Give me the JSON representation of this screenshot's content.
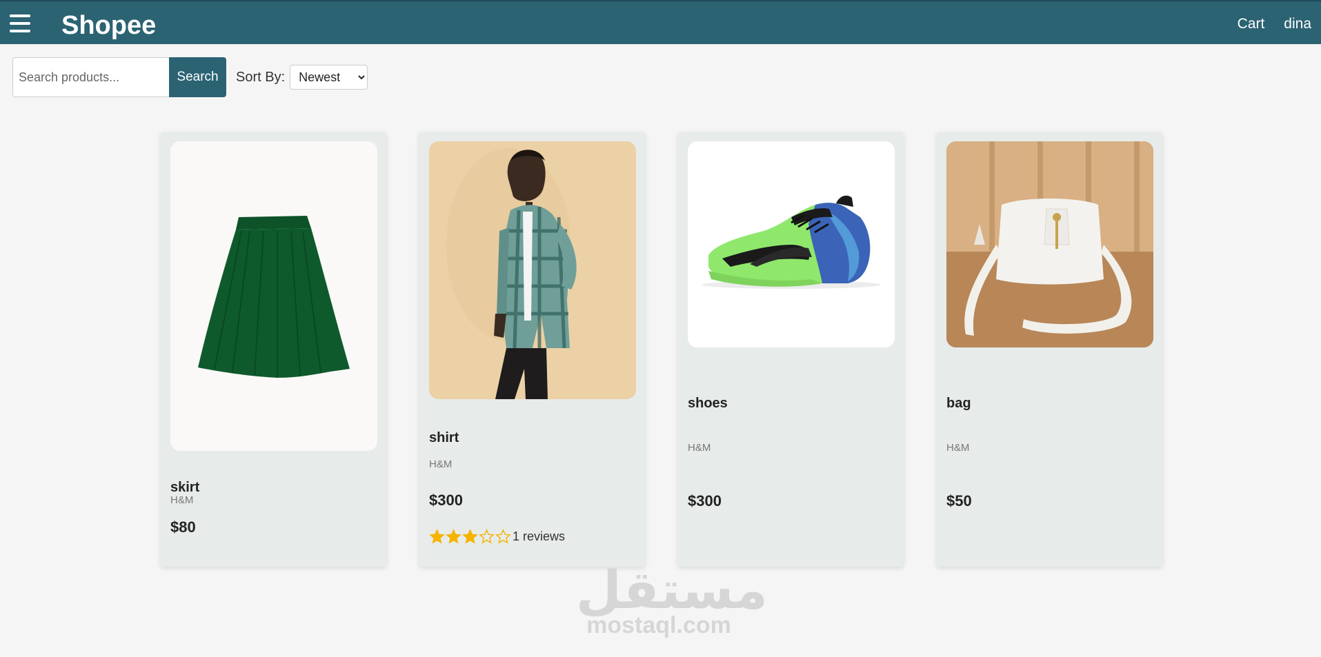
{
  "header": {
    "brand": "Shopee",
    "nav": [
      "Cart",
      "dina"
    ]
  },
  "toolbar": {
    "search_placeholder": "Search products...",
    "search_button": "Search",
    "sort_label": "Sort By:",
    "sort_selected": "Newest"
  },
  "products": [
    {
      "name": "skirt",
      "brand": "H&M",
      "price": "$80"
    },
    {
      "name": "shirt",
      "brand": "H&M",
      "price": "$300",
      "rating": 3,
      "rating_max": 5,
      "reviews": "1 reviews"
    },
    {
      "name": "shoes",
      "brand": "H&M",
      "price": "$300"
    },
    {
      "name": "bag",
      "brand": "H&M",
      "price": "$50"
    }
  ],
  "watermark": {
    "arabic": "مستقل",
    "latin": "mostaql.com"
  },
  "colors": {
    "header": "#2b6373",
    "card": "#e7ebea",
    "star": "#f5b400",
    "skirt": "#0f5a2c"
  }
}
